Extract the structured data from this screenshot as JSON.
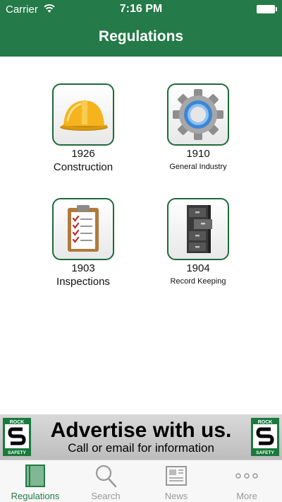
{
  "status": {
    "carrier": "Carrier",
    "time": "7:16 PM"
  },
  "nav": {
    "title": "Regulations"
  },
  "tiles": [
    {
      "code": "1926",
      "label": "Construction",
      "icon": "hard-hat-icon"
    },
    {
      "code": "1910",
      "label": "General Industry",
      "icon": "gear-icon"
    },
    {
      "code": "1903",
      "label": "Inspections",
      "icon": "clipboard-checklist-icon"
    },
    {
      "code": "1904",
      "label": "Record Keeping",
      "icon": "file-cabinet-icon"
    }
  ],
  "ad": {
    "headline": "Advertise with us.",
    "sub": "Call or email for information",
    "logo_top": "ROCK",
    "logo_bottom": "SAFETY"
  },
  "tabs": [
    {
      "label": "Regulations",
      "icon": "book-icon",
      "active": true
    },
    {
      "label": "Search",
      "icon": "magnifier-icon",
      "active": false
    },
    {
      "label": "News",
      "icon": "newspaper-icon",
      "active": false
    },
    {
      "label": "More",
      "icon": "more-dots-icon",
      "active": false
    }
  ],
  "colors": {
    "brand_green": "#247a48",
    "tile_border": "#1d6a3b",
    "hat_yellow": "#f5b41e"
  }
}
